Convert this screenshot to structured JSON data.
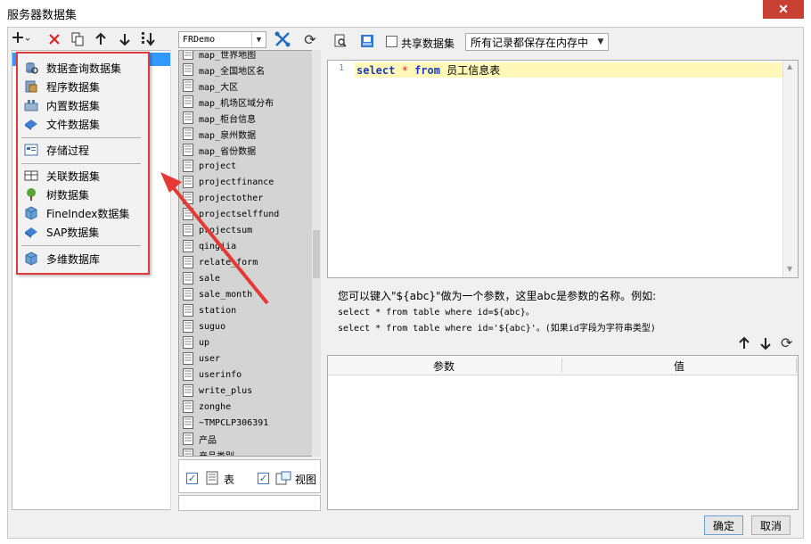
{
  "window": {
    "title": "服务器数据集",
    "close": "✕"
  },
  "left_toolbar": {
    "icons": [
      "add-icon",
      "delete-icon",
      "copy-icon",
      "move-up-icon",
      "move-down-icon",
      "sort-icon"
    ]
  },
  "popup_menu": {
    "items": [
      {
        "label": "数据查询数据集",
        "icon": "database-query-icon"
      },
      {
        "label": "程序数据集",
        "icon": "program-dataset-icon"
      },
      {
        "label": "内置数据集",
        "icon": "builtin-dataset-icon"
      },
      {
        "label": "文件数据集",
        "icon": "file-dataset-icon"
      },
      {
        "label": "存储过程",
        "icon": "stored-procedure-icon"
      },
      {
        "label": "关联数据集",
        "icon": "related-dataset-icon"
      },
      {
        "label": "树数据集",
        "icon": "tree-dataset-icon"
      },
      {
        "label": "FineIndex数据集",
        "icon": "fineindex-dataset-icon"
      },
      {
        "label": "SAP数据集",
        "icon": "sap-dataset-icon"
      },
      {
        "label": "多维数据库",
        "icon": "cube-database-icon"
      }
    ]
  },
  "db_panel": {
    "connection": "FRDemo",
    "tables": [
      "map_世界地图",
      "map_全国地区名",
      "map_大区",
      "map_机场区域分布",
      "map_柜台信息",
      "map_泉州数据",
      "map_省份数据",
      "project",
      "projectfinance",
      "projectother",
      "projectselffund",
      "projectsum",
      "qingjia",
      "relate_form",
      "sale",
      "sale_month",
      "station",
      "suguo",
      "up",
      "user",
      "userinfo",
      "write_plus",
      "zonghe",
      "~TMPCLP306391",
      "产品",
      "产品类别"
    ],
    "filter": {
      "table_label": "表",
      "table_checked": true,
      "view_label": "视图",
      "view_checked": true
    }
  },
  "query_panel": {
    "share_label": "共享数据集",
    "share_checked": false,
    "memory_option": "所有记录都保存在内存中",
    "sql": {
      "line_number": "1",
      "kw_select": "select",
      "star": "*",
      "kw_from": "from",
      "table": "员工信息表"
    },
    "hint_main": "您可以键入\"${abc}\"做为一个参数，这里abc是参数的名称。例如:",
    "hint_line1": "select * from table where id=${abc}。",
    "hint_line2": "select * from table where id='${abc}'。(如果id字段为字符串类型)",
    "param_columns": [
      "参数",
      "值"
    ]
  },
  "buttons": {
    "ok": "确定",
    "cancel": "取消"
  },
  "colors": {
    "accent": "#3399ff",
    "highlight_border": "#e0393c",
    "sql_keyword": "#1d3db8",
    "line_highlight": "#fff8b8"
  }
}
